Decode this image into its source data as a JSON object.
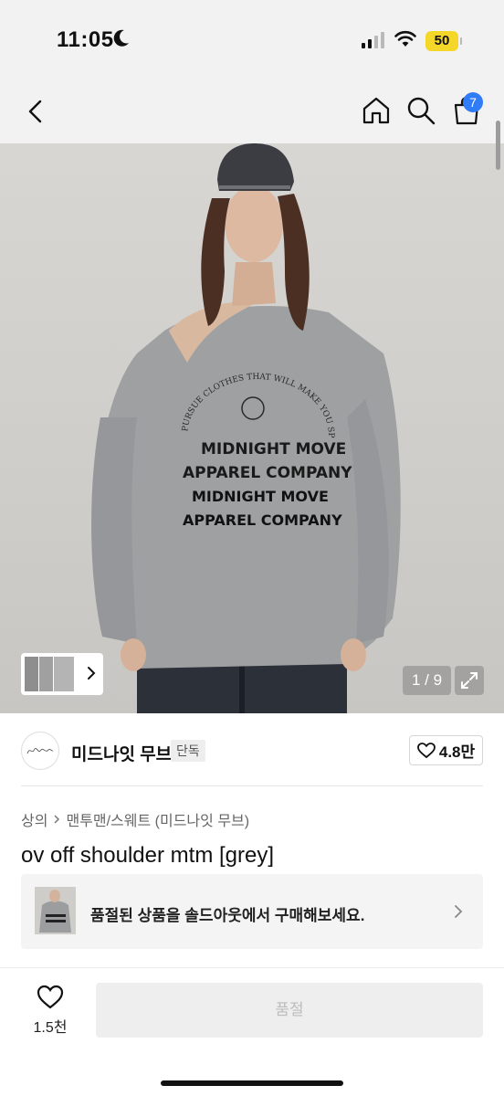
{
  "status_bar": {
    "time": "11:05",
    "battery": "50",
    "icons": [
      "moon-icon",
      "signal-icon",
      "wifi-icon",
      "battery-icon"
    ]
  },
  "nav": {
    "icons": [
      "back-icon",
      "home-icon",
      "search-icon",
      "cart-icon"
    ],
    "cart_count": "7"
  },
  "gallery": {
    "counter": "1 / 9",
    "print_lines": [
      "MIDNIGHT MOVE",
      "APPAREL COMPANY",
      "MIDNIGHT MOVE",
      "APPAREL COMPANY"
    ],
    "print_arc": "PURSUE CLOTHES THAT WILL MAKE YOU SPECIAL"
  },
  "brand": {
    "name": "미드나잇 무브",
    "tag": "단독",
    "likes": "4.8만"
  },
  "breadcrumb": {
    "category": "상의",
    "subcategory": "맨투맨/스웨트 (미드나잇 무브)"
  },
  "product": {
    "title": "ov off shoulder mtm [grey]"
  },
  "soldout_banner": {
    "text": "품절된 상품을 솔드아웃에서 구매해보세요."
  },
  "bottom_bar": {
    "wish_count": "1.5천",
    "button_label": "품절"
  },
  "colors": {
    "accent_badge": "#2f7cf6",
    "battery": "#f5d72a",
    "disabled_button": "#eeeeee"
  }
}
